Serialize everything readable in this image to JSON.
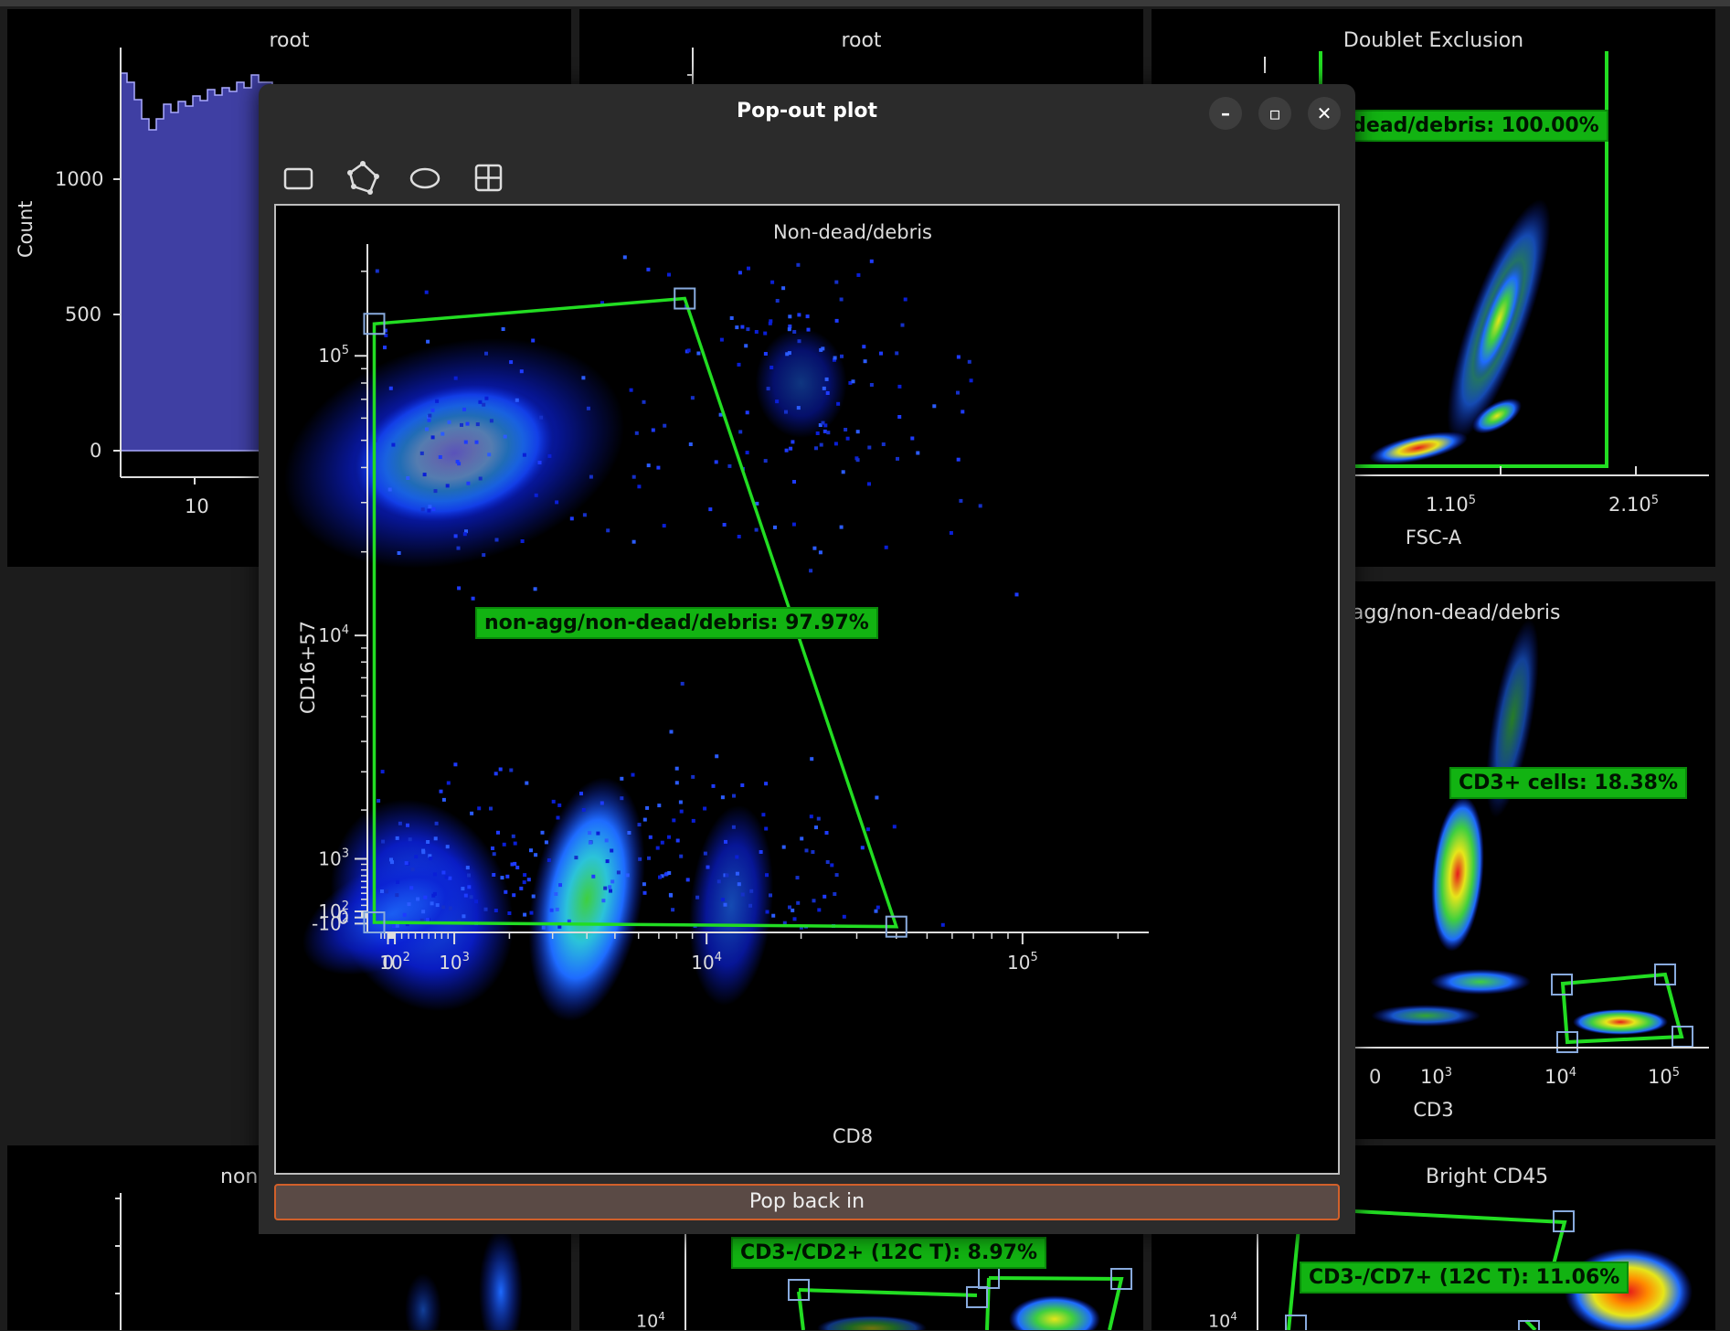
{
  "background_panels": {
    "top_left": {
      "title": "root",
      "ylabel": "Count",
      "yticks": [
        "1000",
        "500",
        "0"
      ],
      "xticks": [
        "10"
      ]
    },
    "top_middle": {
      "title": "root"
    },
    "top_right": {
      "title": "Doublet Exclusion",
      "gate_label": "-dead/debris: 100.00%",
      "xlabel": "FSC-A",
      "xticks": [
        "1.10",
        "2.10"
      ],
      "xtick_exp": "5"
    },
    "mid_right": {
      "title": "non-agg/non-dead/debris",
      "gate_label": "CD3+ cells: 18.38%",
      "xlabel": "CD3",
      "xticks": [
        "0",
        "10",
        "10",
        "10"
      ],
      "xtick_exps": [
        "",
        "3",
        "4",
        "5"
      ]
    },
    "bottom_left": {
      "title": "non-"
    },
    "bottom_middle": {
      "gate_label": "CD3-/CD2+ (12C T): 8.97%",
      "ytick": "10",
      "ytick_exp": "4"
    },
    "bottom_right": {
      "title": "Bright CD45",
      "gate_label": "CD3-/CD7+ (12C T): 11.06%",
      "ytick": "10",
      "ytick_exp": "4"
    }
  },
  "window": {
    "title": "Pop-out plot",
    "controls": {
      "minimize": "–",
      "maximize": "▫",
      "close": "✕"
    },
    "tools": [
      "rectangle-gate-tool",
      "polygon-gate-tool",
      "ellipse-gate-tool",
      "quadrant-gate-tool"
    ],
    "pop_back_label": "Pop back in",
    "plot": {
      "title": "Non-dead/debris",
      "xlabel": "CD8",
      "ylabel": "CD16+57",
      "gate_label": "non-agg/non-dead/debris: 97.97%",
      "gate_color": "#22dd22"
    }
  },
  "chart_data": {
    "type": "scatter",
    "title": "Non-dead/debris",
    "xlabel": "CD8",
    "ylabel": "CD16+57",
    "xscale": "biexponential",
    "yscale": "biexponential",
    "x_ticks": [
      {
        "base": "0",
        "exp": ""
      },
      {
        "base": "10",
        "exp": "2"
      },
      {
        "base": "10",
        "exp": "3"
      },
      {
        "base": "10",
        "exp": "4"
      },
      {
        "base": "10",
        "exp": "5"
      }
    ],
    "y_ticks": [
      {
        "base": "-10",
        "exp": "2"
      },
      {
        "base": "0",
        "exp": ""
      },
      {
        "base": "10",
        "exp": "2"
      },
      {
        "base": "10",
        "exp": "3"
      },
      {
        "base": "10",
        "exp": "4"
      },
      {
        "base": "10",
        "exp": "5"
      }
    ],
    "clusters": [
      {
        "name": "",
        "x": 1000,
        "y": 45000,
        "density": "high"
      },
      {
        "name": "",
        "x": 4000,
        "y": 300,
        "density": "medium"
      },
      {
        "name": "",
        "x": 500,
        "y": 200,
        "density": "low"
      },
      {
        "name": "",
        "x": 60,
        "y": 60,
        "density": "low"
      },
      {
        "name": "",
        "x": 12000,
        "y": 200,
        "density": "low"
      },
      {
        "name": "",
        "x": 20000,
        "y": 80000,
        "density": "low"
      }
    ],
    "gate": {
      "name": "non-agg/non-dead/debris",
      "percent": "97.97%",
      "vertices": [
        [
          -200,
          130000
        ],
        [
          8500,
          160000
        ],
        [
          40000,
          -150
        ],
        [
          -200,
          -80
        ]
      ]
    },
    "colormap": [
      "#0a1fd6",
      "#1e6bff",
      "#2bc3d9",
      "#3fcf3f",
      "#e6e61a",
      "#ff8c00",
      "#e61a1a"
    ]
  }
}
